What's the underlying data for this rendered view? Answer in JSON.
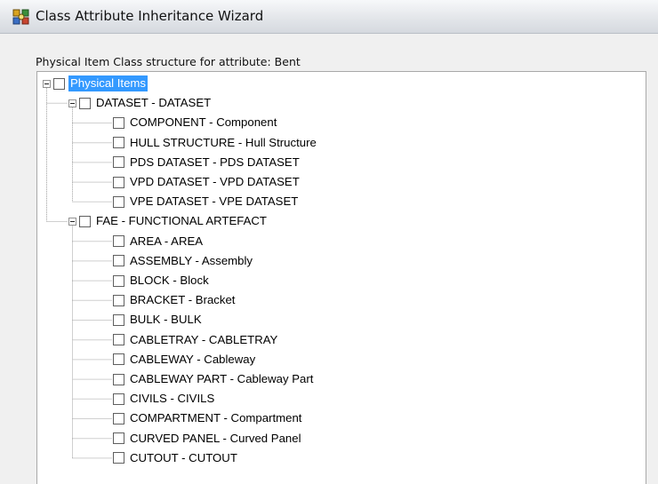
{
  "window": {
    "title": "Class Attribute Inheritance Wizard",
    "icon": "class-wizard-icon"
  },
  "header_label": "Physical Item Class structure for attribute: Bent",
  "tree": {
    "root": {
      "label": "Physical Items",
      "checked": false,
      "selected": true,
      "expanded": true
    },
    "groups": [
      {
        "label": "DATASET - DATASET",
        "checked": false,
        "expanded": true,
        "children": [
          {
            "label": "COMPONENT - Component",
            "checked": false
          },
          {
            "label": "HULL STRUCTURE - Hull Structure",
            "checked": false
          },
          {
            "label": "PDS DATASET - PDS DATASET",
            "checked": false
          },
          {
            "label": "VPD DATASET - VPD DATASET",
            "checked": false
          },
          {
            "label": "VPE DATASET - VPE DATASET",
            "checked": false
          }
        ]
      },
      {
        "label": "FAE - FUNCTIONAL ARTEFACT",
        "checked": false,
        "expanded": true,
        "children": [
          {
            "label": "AREA - AREA",
            "checked": false
          },
          {
            "label": "ASSEMBLY - Assembly",
            "checked": false
          },
          {
            "label": "BLOCK - Block",
            "checked": false
          },
          {
            "label": "BRACKET - Bracket",
            "checked": false
          },
          {
            "label": "BULK - BULK",
            "checked": false
          },
          {
            "label": "CABLETRAY - CABLETRAY",
            "checked": false
          },
          {
            "label": "CABLEWAY - Cableway",
            "checked": false
          },
          {
            "label": "CABLEWAY PART - Cableway Part",
            "checked": false
          },
          {
            "label": "CIVILS - CIVILS",
            "checked": false
          },
          {
            "label": "COMPARTMENT - Compartment",
            "checked": false
          },
          {
            "label": "CURVED PANEL - Curved Panel",
            "checked": false
          },
          {
            "label": "CUTOUT - CUTOUT",
            "checked": false
          }
        ]
      }
    ]
  }
}
